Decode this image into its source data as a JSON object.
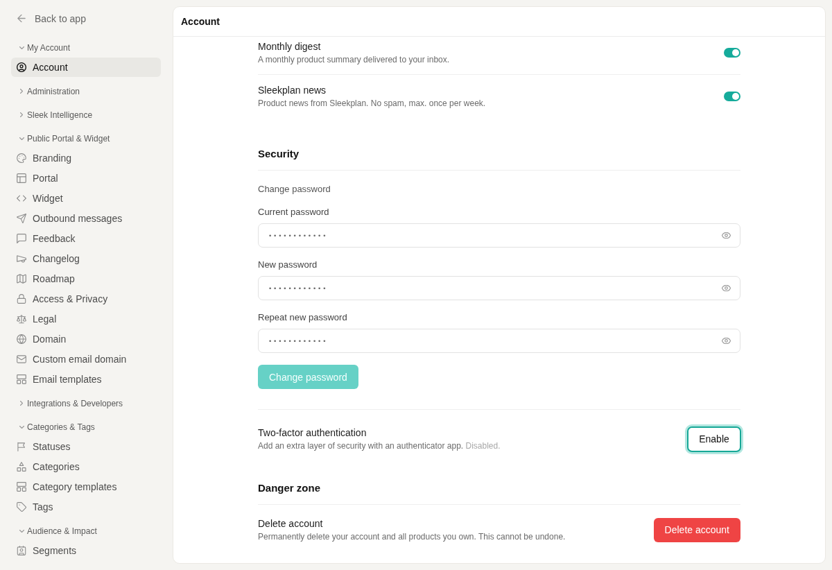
{
  "sidebar": {
    "back_link": "Back to app",
    "groups": [
      {
        "label": "My Account",
        "expanded": true,
        "items": [
          {
            "label": "Account",
            "selected": true
          }
        ]
      },
      {
        "label": "Administration",
        "expanded": false
      },
      {
        "label": "Sleek Intelligence",
        "expanded": false
      },
      {
        "label": "Public Portal & Widget",
        "expanded": true,
        "items": [
          {
            "label": "Branding",
            "selected": false
          },
          {
            "label": "Portal",
            "selected": false
          },
          {
            "label": "Widget",
            "selected": false
          },
          {
            "label": "Outbound messages",
            "selected": false
          },
          {
            "label": "Feedback",
            "selected": false
          },
          {
            "label": "Changelog",
            "selected": false
          },
          {
            "label": "Roadmap",
            "selected": false
          },
          {
            "label": "Access & Privacy",
            "selected": false
          },
          {
            "label": "Legal",
            "selected": false
          },
          {
            "label": "Domain",
            "selected": false
          },
          {
            "label": "Custom email domain",
            "selected": false
          },
          {
            "label": "Email templates",
            "selected": false
          }
        ]
      },
      {
        "label": "Integrations & Developers",
        "expanded": false
      },
      {
        "label": "Categories & Tags",
        "expanded": true,
        "items": [
          {
            "label": "Statuses",
            "selected": false
          },
          {
            "label": "Categories",
            "selected": false
          },
          {
            "label": "Category templates",
            "selected": false
          },
          {
            "label": "Tags",
            "selected": false
          }
        ]
      },
      {
        "label": "Audience & Impact",
        "expanded": true,
        "items": [
          {
            "label": "Segments",
            "selected": false
          }
        ]
      }
    ]
  },
  "header": {
    "title": "Account"
  },
  "notifications": [
    {
      "title": "Monthly digest",
      "description": "A monthly product summary delivered to your inbox.",
      "on": true
    },
    {
      "title": "Sleekplan news",
      "description": "Product news from Sleekplan. No spam, max. once per week.",
      "on": true
    }
  ],
  "security": {
    "heading": "Security",
    "subheading": "Change password",
    "fields": [
      {
        "label": "Current password",
        "value": "••••••••••••"
      },
      {
        "label": "New password",
        "value": "••••••••••••"
      },
      {
        "label": "Repeat new password",
        "value": "••••••••••••"
      }
    ],
    "submit": {
      "label": "Change password",
      "disabled": true
    },
    "two_factor": {
      "title": "Two-factor authentication",
      "description": "Add an extra layer of security with an authenticator app.",
      "status": "Disabled.",
      "button": {
        "label": "Enable",
        "focused": true
      }
    }
  },
  "danger_zone": {
    "heading": "Danger zone",
    "title": "Delete account",
    "description": "Permanently delete your account and all products you own. This cannot be undone.",
    "button": "Delete account"
  }
}
